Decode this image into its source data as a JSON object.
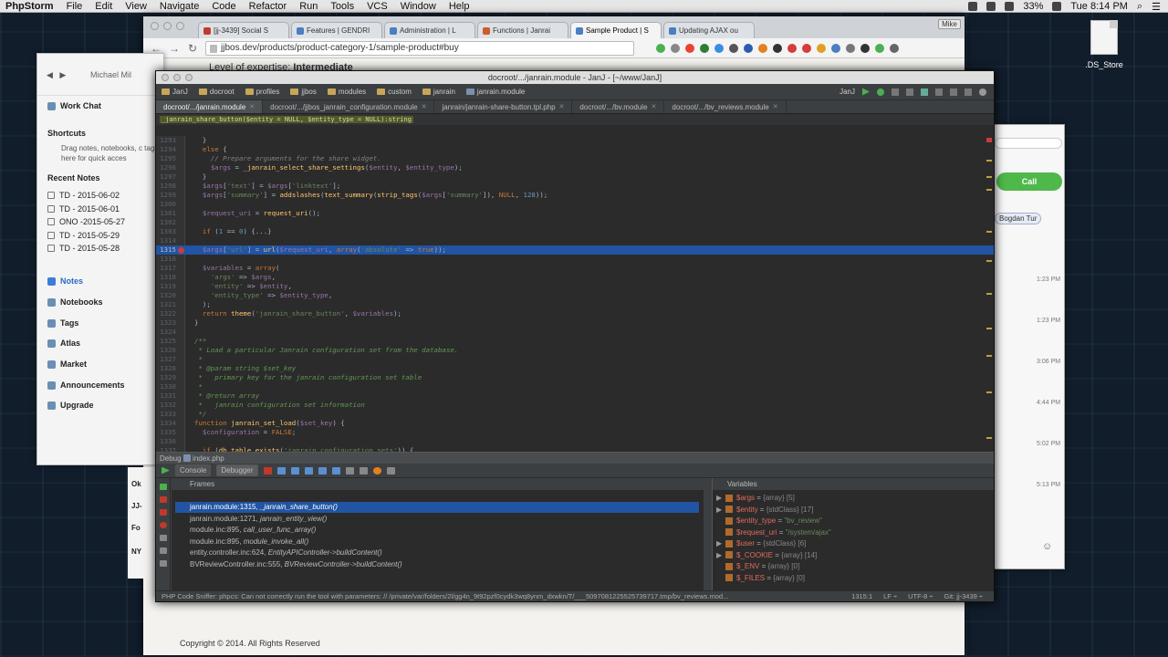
{
  "menubar": {
    "app": "PhpStorm",
    "items": [
      "File",
      "Edit",
      "View",
      "Navigate",
      "Code",
      "Refactor",
      "Run",
      "Tools",
      "VCS",
      "Window",
      "Help"
    ],
    "battery": "33%",
    "clock": "Tue 8:14 PM"
  },
  "desktop": {
    "file_label": ".DS_Store"
  },
  "browser": {
    "tabs": [
      {
        "label": "[jj-3439] Social S",
        "color": "#c23b2f"
      },
      {
        "label": "Features | GENDRI",
        "color": "#4a7fc1"
      },
      {
        "label": "Administration | L",
        "color": "#4a7fc1"
      },
      {
        "label": "Functions | Janrai",
        "color": "#d05a2a"
      },
      {
        "label": "Sample Product | S",
        "color": "#4a7fc1"
      },
      {
        "label": "Updating AJAX ou",
        "color": "#4a7fc1"
      }
    ],
    "user_tab": "Mike",
    "url": "jjbos.dev/products/product-category-1/sample-product#buy",
    "page": {
      "expertise_label": "Level of expertise:",
      "expertise_value": "Intermediate",
      "copyright": "Copyright © 2014. All Rights Reserved"
    }
  },
  "evernote": {
    "user": "Michael Mil",
    "work_chat": "Work Chat",
    "shortcuts": "Shortcuts",
    "shortcuts_desc": "Drag notes, notebooks, c tags here for quick acces",
    "recent_notes": "Recent Notes",
    "notes": [
      "TD - 2015-06-02",
      "TD - 2015-06-01",
      "ONO -2015-05-27",
      "TD - 2015-05-29",
      "TD - 2015-05-28"
    ],
    "nav": [
      "Notes",
      "Notebooks",
      "Tags",
      "Atlas",
      "Market",
      "Announcements",
      "Upgrade"
    ]
  },
  "skype": {
    "call": "Call",
    "contact": "Bogdan Tur",
    "times": [
      "1:23 PM",
      "1:23 PM",
      "3:06 PM",
      "4:44 PM",
      "5:02 PM",
      "5:13 PM"
    ]
  },
  "chat_under": [
    "Ok",
    "JJ-",
    "Fo",
    "NY"
  ],
  "ide": {
    "title": "docroot/.../janrain.module - JanJ - [~/www/JanJ]",
    "breadcrumbs": [
      "JanJ",
      "docroot",
      "profiles",
      "jjbos",
      "modules",
      "custom",
      "janrain",
      "janrain.module"
    ],
    "run_config": "JanJ",
    "tabs": [
      {
        "label": "docroot/.../janrain.module",
        "active": true
      },
      {
        "label": "docroot/.../jjbos_janrain_configuration.module",
        "active": false
      },
      {
        "label": "janrain/janrain-share-button.tpl.php",
        "active": false
      },
      {
        "label": "docroot/.../bv.module",
        "active": false
      },
      {
        "label": "docroot/.../bv_reviews.module",
        "active": false
      }
    ],
    "signature": "_janrain_share_button($entity = NULL, $entity_type = NULL):string",
    "code": [
      {
        "n": "1293",
        "t": "  }"
      },
      {
        "n": "1294",
        "t": "  else {"
      },
      {
        "n": "1295",
        "t": "    // Prepare arguments for the share widget."
      },
      {
        "n": "1296",
        "t": "    $args = _janrain_select_share_settings($entity, $entity_type);"
      },
      {
        "n": "1297",
        "t": "  }"
      },
      {
        "n": "1298",
        "t": "  $args['text'] = $args['linktext'];"
      },
      {
        "n": "1299",
        "t": "  $args['summary'] = addslashes(text_summary(strip_tags($args['summary']), NULL, 128));"
      },
      {
        "n": "1300",
        "t": ""
      },
      {
        "n": "1301",
        "t": "  $request_uri = request_uri();"
      },
      {
        "n": "1302",
        "t": ""
      },
      {
        "n": "1303",
        "t": "  if (1 == 0) {...}"
      },
      {
        "n": "1314",
        "t": ""
      },
      {
        "n": "1315",
        "t": "  $args['url'] = url($request_uri, array('absolute' => true));"
      },
      {
        "n": "1316",
        "t": ""
      },
      {
        "n": "1317",
        "t": "  $variables = array("
      },
      {
        "n": "1318",
        "t": "    'args' => $args,"
      },
      {
        "n": "1319",
        "t": "    'entity' => $entity,"
      },
      {
        "n": "1320",
        "t": "    'entity_type' => $entity_type,"
      },
      {
        "n": "1321",
        "t": "  );"
      },
      {
        "n": "1322",
        "t": "  return theme('janrain_share_button', $variables);"
      },
      {
        "n": "1323",
        "t": "}"
      },
      {
        "n": "1324",
        "t": ""
      },
      {
        "n": "1325",
        "t": "/**"
      },
      {
        "n": "1326",
        "t": " * Load a particular Janrain configuration set from the database."
      },
      {
        "n": "1327",
        "t": " *"
      },
      {
        "n": "1328",
        "t": " * @param string $set_key"
      },
      {
        "n": "1329",
        "t": " *   primary key for the janrain configuration set table"
      },
      {
        "n": "1330",
        "t": " *"
      },
      {
        "n": "1331",
        "t": " * @return array"
      },
      {
        "n": "1332",
        "t": " *   janrain configuration set information"
      },
      {
        "n": "1333",
        "t": " */"
      },
      {
        "n": "1334",
        "t": "function janrain_set_load($set_key) {"
      },
      {
        "n": "1335",
        "t": "  $configuration = FALSE;"
      },
      {
        "n": "1336",
        "t": ""
      },
      {
        "n": "1337",
        "t": "  if (db_table_exists('janrain_configuration_sets')) {"
      }
    ],
    "debug": {
      "title": "Debug",
      "file": "index.php",
      "console_tab": "Console",
      "debugger_tab": "Debugger",
      "frames_label": "Frames",
      "variables_label": "Variables",
      "frames": [
        {
          "loc": "janrain.module:1315,",
          "fn": "_janrain_share_button()"
        },
        {
          "loc": "janrain.module:1271,",
          "fn": "janrain_entity_view()"
        },
        {
          "loc": "module.inc:895,",
          "fn": "call_user_func_array()"
        },
        {
          "loc": "module.inc:895,",
          "fn": "module_invoke_all()"
        },
        {
          "loc": "entity.controller.inc:624,",
          "fn": "EntityAPIController->buildContent()"
        },
        {
          "loc": "BVReviewController.inc:555,",
          "fn": "BVReviewController->buildContent()"
        }
      ],
      "variables": [
        {
          "name": "$args",
          "value": "{array} [5]",
          "expandable": true
        },
        {
          "name": "$entity",
          "value": "{stdClass} [17]",
          "expandable": true
        },
        {
          "name": "$entity_type",
          "value": "\"bv_review\"",
          "expandable": false
        },
        {
          "name": "$request_uri",
          "value": "\"/system/ajax\"",
          "expandable": false
        },
        {
          "name": "$user",
          "value": "{stdClass} [6]",
          "expandable": true
        },
        {
          "name": "$_COOKIE",
          "value": "{array} [14]",
          "expandable": true
        },
        {
          "name": "$_ENV",
          "value": "{array} [0]",
          "expandable": false
        },
        {
          "name": "$_FILES",
          "value": "{array} [0]",
          "expandable": false
        }
      ]
    },
    "status": {
      "message": "PHP Code Sniffer: phpcs: Can not correctly run the tool with parameters: // /private/var/folders/2l/gg4n_9t92pzf0cydk3wq8ynm_dxwkn/T/___5097081225525739717.tmp/bv_reviews.mod...",
      "position": "1315:1",
      "line_sep": "LF ÷",
      "encoding": "UTF-8 ÷",
      "git": "Git: jj-3439 ÷"
    }
  }
}
